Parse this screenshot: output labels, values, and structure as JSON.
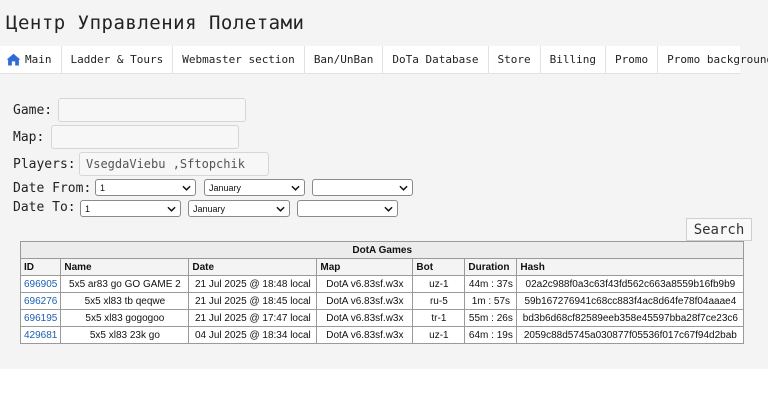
{
  "page_title": "Центр Управления Полетами",
  "nav": {
    "items": [
      {
        "label": "Main"
      },
      {
        "label": "Ladder & Tours"
      },
      {
        "label": "Webmaster section"
      },
      {
        "label": "Ban/UnBan"
      },
      {
        "label": "DoTa Database"
      },
      {
        "label": "Store"
      },
      {
        "label": "Billing"
      },
      {
        "label": "Promo"
      },
      {
        "label": "Promo background"
      }
    ]
  },
  "form": {
    "game_label": "Game:",
    "game_value": "",
    "map_label": "Map:",
    "map_value": "",
    "players_label": "Players:",
    "players_value": "VsegdaViebu ,Sftopchik",
    "date_from_label": "Date From:",
    "date_from": {
      "day": "1",
      "month": "January",
      "year": ""
    },
    "date_to_label": "Date To:",
    "date_to": {
      "day": "1",
      "month": "January",
      "year": ""
    },
    "search_label": "Search"
  },
  "table": {
    "caption": "DotA Games",
    "headers": [
      "ID",
      "Name",
      "Date",
      "Map",
      "Bot",
      "Duration",
      "Hash"
    ],
    "rows": [
      {
        "id": "696905",
        "name": "5x5 ar83 go GO GAME 2",
        "date": "21 Jul 2025 @ 18:48 local",
        "map": "DotA v6.83sf.w3x",
        "bot": "uz-1",
        "duration": "44m : 37s",
        "hash": "02a2c988f0a3c63f43fd562c663a8559b16fb9b9"
      },
      {
        "id": "696276",
        "name": "5x5 xl83 tb qeqwe",
        "date": "21 Jul 2025 @ 18:45 local",
        "map": "DotA v6.83sf.w3x",
        "bot": "ru-5",
        "duration": "1m : 57s",
        "hash": "59b167276941c68cc883f4ac8d64fe78f04aaae4"
      },
      {
        "id": "696195",
        "name": "5x5 xl83 gogogoo",
        "date": "21 Jul 2025 @ 17:47 local",
        "map": "DotA v6.83sf.w3x",
        "bot": "tr-1",
        "duration": "55m : 26s",
        "hash": "bd3b6d68cf82589eeb358e45597bba28f7ce23c6"
      },
      {
        "id": "429681",
        "name": "5x5 xl83 23k go",
        "date": "04 Jul 2025 @ 18:34 local",
        "map": "DotA v6.83sf.w3x",
        "bot": "uz-1",
        "duration": "64m : 19s",
        "hash": "2059c88d5745a030877f05536f017c67f94d2bab"
      }
    ]
  },
  "colors": {
    "link": "#1a5fb4",
    "home_icon": "#2e6bd6"
  },
  "icons": {
    "home": "home-icon",
    "dropdown": "chevron-down-icon"
  }
}
